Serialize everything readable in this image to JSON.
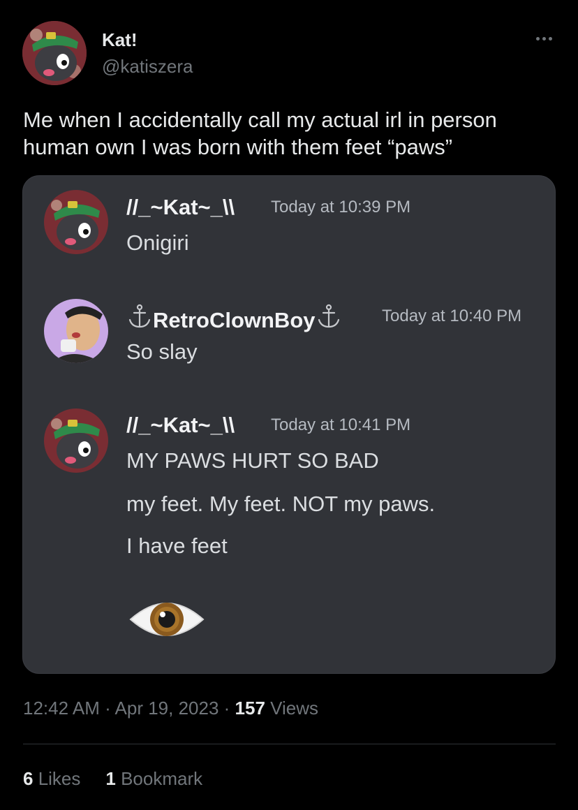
{
  "author": {
    "name": "Kat!",
    "handle": "@katiszera"
  },
  "tweet": {
    "text_line1": "Me when I accidentally call my actual irl in person",
    "text_line2": "human own I was born with them feet “paws”"
  },
  "discord": {
    "messages": [
      {
        "username": "//_~Kat~_\\\\",
        "timestamp": "Today at 10:39 PM",
        "lines": [
          "Onigiri"
        ]
      },
      {
        "username": "RetroClownBoy",
        "timestamp": "Today at 10:40 PM",
        "lines": [
          "So slay"
        ]
      },
      {
        "username": "//_~Kat~_\\\\",
        "timestamp": "Today at 10:41 PM",
        "lines": [
          "MY PAWS HURT SO BAD",
          "my feet. My feet. NOT my paws.",
          "I have feet"
        ],
        "emoji": "eye-emoji"
      }
    ]
  },
  "meta": {
    "time": "12:42 AM",
    "separator": " · ",
    "date": "Apr 19, 2023",
    "views_count": "157",
    "views_label": " Views"
  },
  "stats": {
    "likes_count": "6",
    "likes_label": " Likes",
    "bookmarks_count": "1",
    "bookmarks_label": " Bookmark"
  },
  "colors": {
    "background": "#000000",
    "text_primary": "#e7e9ea",
    "text_secondary": "#71767b",
    "discord_bg": "#313338",
    "discord_text": "#dbdee1",
    "discord_timestamp": "#b5bac1"
  }
}
